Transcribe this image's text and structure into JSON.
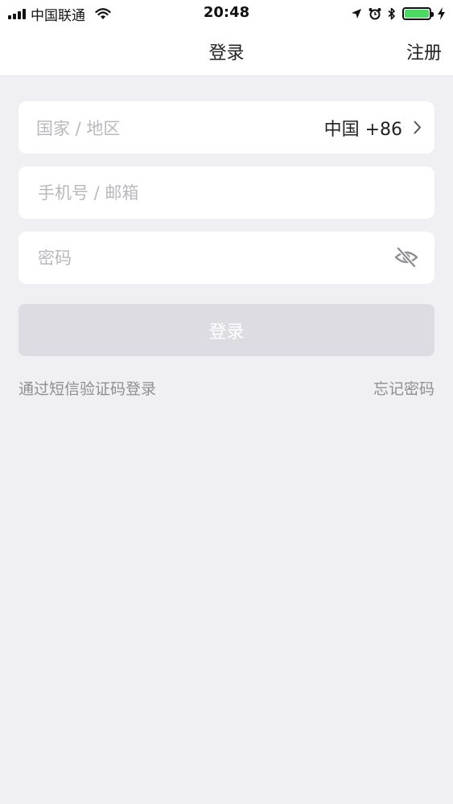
{
  "status_bar": {
    "carrier": "中国联通",
    "time": "20:48",
    "battery_level": 1.0
  },
  "nav": {
    "title": "登录",
    "register": "注册"
  },
  "form": {
    "country_label": "国家 / 地区",
    "country_value": "中国 +86",
    "account_placeholder": "手机号 / 邮箱",
    "password_placeholder": "密码",
    "login_button": "登录"
  },
  "links": {
    "sms_login": "通过短信验证码登录",
    "forgot_password": "忘记密码"
  },
  "colors": {
    "background": "#efeff4",
    "button_disabled": "#dcdce2",
    "placeholder": "#b8b8bd",
    "link": "#8e8e93",
    "battery": "#4cd964"
  }
}
